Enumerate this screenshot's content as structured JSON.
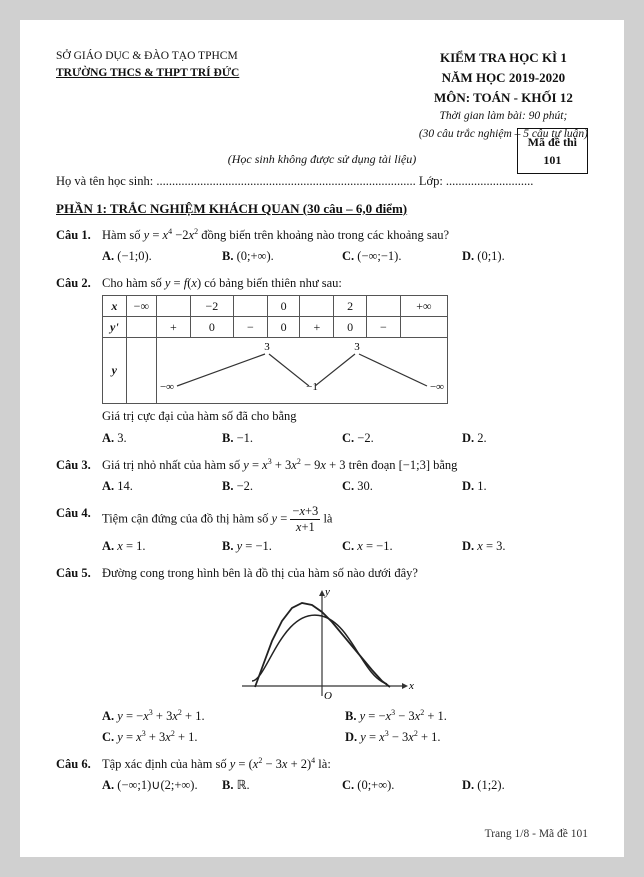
{
  "header": {
    "department": "SỞ GIÁO DỤC & ĐÀO TẠO TPHCM",
    "school": "TRƯỜNG THCS & THPT TRÍ ĐỨC",
    "exam_title": "KIỂM TRA HỌC KÌ 1",
    "school_year": "NĂM HỌC 2019-2020",
    "subject": "MÔN: TOÁN - KHỐI 12",
    "time_note": "Thời gian làm bài: 90 phút;",
    "time_note2": "(30 câu trắc nghiệm – 5 câu tự luận)",
    "ma_de_label": "Mã đề thi",
    "ma_de_number": "101"
  },
  "note": "(Học sinh không được sử dụng tài liệu)",
  "student_line": "Họ và tên học sinh: ...................................................................................  Lớp: ............................",
  "section1_title": "PHẦN 1: TRẮC NGHIỆM KHÁCH QUAN (30 câu – 6,0 điểm)",
  "questions": [
    {
      "num": "Câu 1.",
      "text": "Hàm số y = x⁴ − 2x² đồng biến trên khoảng nào trong các khoảng sau?",
      "options": [
        {
          "label": "A.",
          "value": "(−1;0)"
        },
        {
          "label": "B.",
          "value": "(0;+∞)"
        },
        {
          "label": "C.",
          "value": "(−∞;−1)"
        },
        {
          "label": "D.",
          "value": "(0;1)"
        }
      ]
    },
    {
      "num": "Câu 2.",
      "text": "Cho hàm số y = f(x) có bảng biến thiên như sau:",
      "has_variation": true,
      "variation_note": "Giá trị cực đại của hàm số đã cho bằng",
      "options": [
        {
          "label": "A.",
          "value": "3"
        },
        {
          "label": "B.",
          "value": "−1"
        },
        {
          "label": "C.",
          "value": "−2"
        },
        {
          "label": "D.",
          "value": "2"
        }
      ]
    },
    {
      "num": "Câu 3.",
      "text": "Giá trị nhỏ nhất của hàm số y = x³ + 3x² − 9x + 3 trên đoạn [−1;3] bằng",
      "options": [
        {
          "label": "A.",
          "value": "14"
        },
        {
          "label": "B.",
          "value": "−2"
        },
        {
          "label": "C.",
          "value": "30"
        },
        {
          "label": "D.",
          "value": "1"
        }
      ]
    },
    {
      "num": "Câu 4.",
      "text": "Tiệm cận đứng của đồ thị hàm số y = (−x+3)/(x+1) là",
      "options": [
        {
          "label": "A.",
          "value": "x = 1"
        },
        {
          "label": "B.",
          "value": "y = −1"
        },
        {
          "label": "C.",
          "value": "x = −1"
        },
        {
          "label": "D.",
          "value": "x = 3"
        }
      ]
    },
    {
      "num": "Câu 5.",
      "text": "Đường cong trong hình bên là đồ thị của hàm số nào dưới đây?",
      "has_graph": true,
      "options2col": [
        {
          "label": "A.",
          "value": "y = −x³ + 3x² + 1"
        },
        {
          "label": "B.",
          "value": "y = −x³ − 3x² + 1"
        },
        {
          "label": "C.",
          "value": "y = x³ + 3x² + 1"
        },
        {
          "label": "D.",
          "value": "y = x³ − 3x² + 1"
        }
      ]
    },
    {
      "num": "Câu 6.",
      "text": "Tập xác định của hàm số y = (x² − 3x + 2)⁴ là:",
      "options": [
        {
          "label": "A.",
          "value": "(−∞;1)∪(2;+∞)"
        },
        {
          "label": "B.",
          "value": "ℝ"
        },
        {
          "label": "C.",
          "value": "(0;+∞)"
        },
        {
          "label": "D.",
          "value": "(1;2)"
        }
      ]
    }
  ],
  "footer": "Trang 1/8 - Mã đề 101"
}
